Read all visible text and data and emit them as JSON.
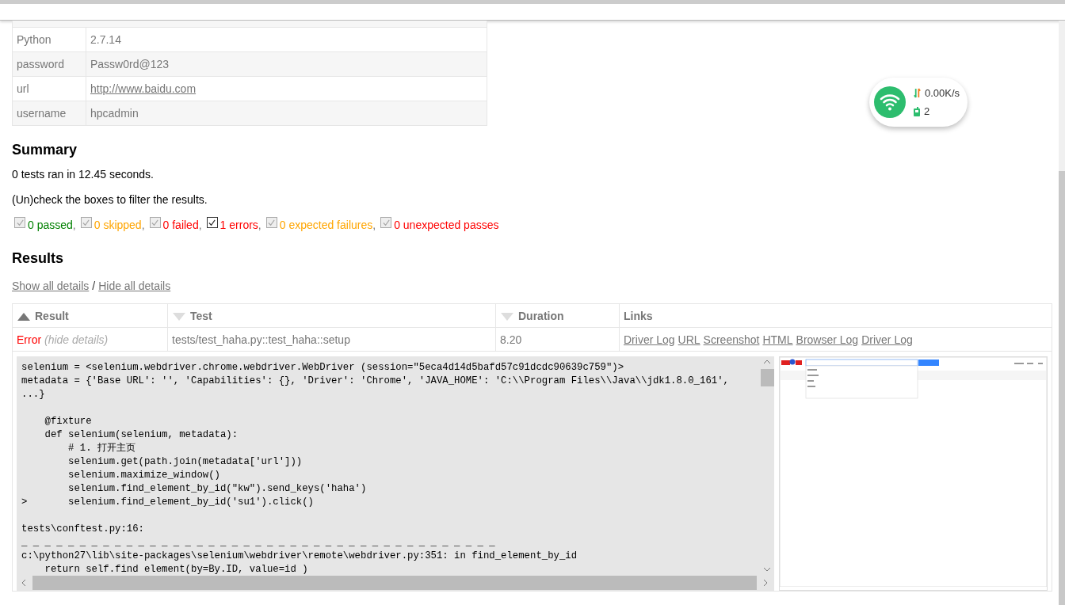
{
  "environment": [
    {
      "key": "Python",
      "value": "2.7.14",
      "link": false
    },
    {
      "key": "password",
      "value": "Passw0rd@123",
      "link": false
    },
    {
      "key": "url",
      "value": "http://www.baidu.com",
      "link": true
    },
    {
      "key": "username",
      "value": "hpcadmin",
      "link": false
    }
  ],
  "summary": {
    "title": "Summary",
    "ran": "0 tests ran in 12.45 seconds.",
    "hint": "(Un)check the boxes to filter the results.",
    "filters": [
      {
        "label": "0 passed",
        "suffix": ",",
        "checked": true,
        "disabled": true,
        "color": "#008000"
      },
      {
        "label": "0 skipped",
        "suffix": ",",
        "checked": true,
        "disabled": true,
        "color": "#ffa500"
      },
      {
        "label": "0 failed",
        "suffix": ",",
        "checked": true,
        "disabled": true,
        "color": "#ff0000"
      },
      {
        "label": "1 errors",
        "suffix": ",",
        "checked": true,
        "disabled": false,
        "color": "#ff0000"
      },
      {
        "label": "0 expected failures",
        "suffix": ",",
        "checked": true,
        "disabled": true,
        "color": "#ffa500"
      },
      {
        "label": "0 unexpected passes",
        "checked": true,
        "disabled": true,
        "color": "#ff0000"
      }
    ]
  },
  "results": {
    "title": "Results",
    "show_all": "Show all details",
    "separator": "/",
    "hide_all": "Hide all details",
    "columns": [
      {
        "label": "Result",
        "sorted": true
      },
      {
        "label": "Test",
        "sorted": false
      },
      {
        "label": "Duration",
        "sorted": false
      },
      {
        "label": "Links"
      }
    ],
    "rows": [
      {
        "result": "Error",
        "toggle": "(hide details)",
        "test": "tests/test_haha.py::test_haha::setup",
        "duration": "8.20",
        "links": [
          "Driver Log",
          "URL",
          "Screenshot",
          "HTML",
          "Browser Log",
          "Driver Log"
        ],
        "log": [
          [
            "selenium = <selenium.webdriver.chrome.webdriver.WebDriver (session=\"5eca4d14d5bafd57c91dcdc90639c759\")>",
            "metadata = {'Base URL': '', 'Capabilities': {}, 'Driver': 'Chrome', 'JAVA_HOME': 'C:\\\\Program Files\\\\Java\\\\jdk1.8.0_161',",
            "...}"
          ],
          [
            "    @fixture",
            "    def selenium(selenium, metadata):",
            "        # 1. 打开主页",
            "        selenium.get(path.join(metadata['url']))",
            "        selenium.maximize_window()",
            "        selenium.find_element_by_id(\"kw\").send_keys('haha')",
            ">       selenium.find_element_by_id('su1').click()"
          ],
          [
            "tests\\conftest.py:16:",
            "_ _ _ _ _ _ _ _ _ _ _ _ _ _ _ _ _ _ _ _ _ _ _ _ _ _ _ _ _ _ _ _ _ _ _ _ _ _ _ _ _",
            "c:\\python27\\lib\\site-packages\\selenium\\webdriver\\remote\\webdriver.py:351: in find_element_by_id",
            "    return self.find element(by=By.ID, value=id )"
          ]
        ]
      }
    ]
  },
  "network_widget": {
    "speed": "0.00K/s",
    "count": "2"
  }
}
